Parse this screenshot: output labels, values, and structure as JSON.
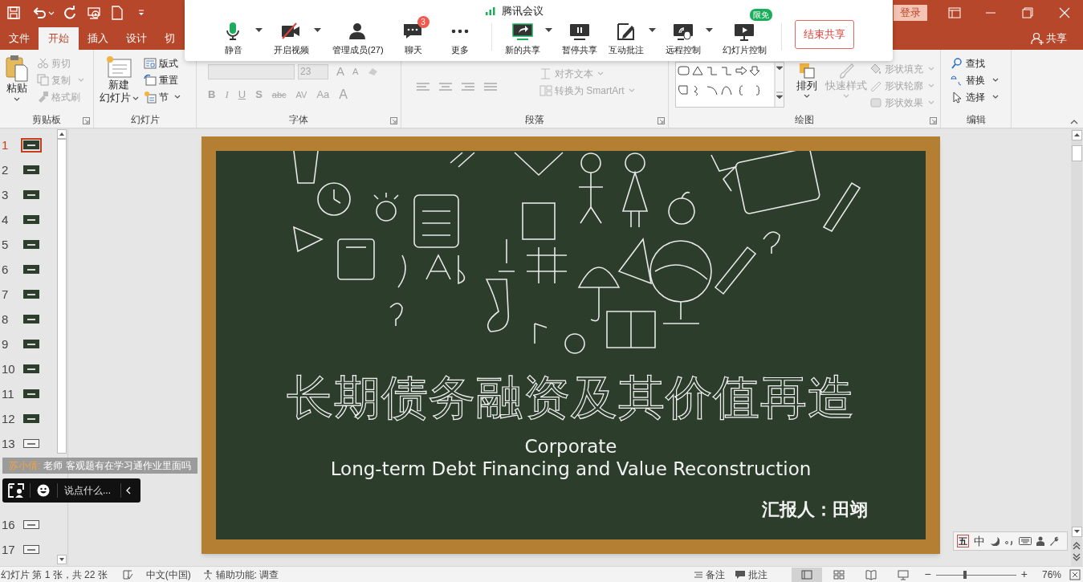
{
  "title_bar": {
    "login": "登录"
  },
  "ribbon_tabs": [
    {
      "label": "文件",
      "selected": false
    },
    {
      "label": "开始",
      "selected": true
    },
    {
      "label": "插入",
      "selected": false
    },
    {
      "label": "设计",
      "selected": false
    },
    {
      "label": "切",
      "selected": false
    }
  ],
  "share": "共享",
  "ribbon": {
    "clipboard": {
      "label": "剪贴板",
      "paste": "粘贴",
      "items": [
        {
          "label": "剪切",
          "disabled": true
        },
        {
          "label": "复制",
          "disabled": true
        },
        {
          "label": "格式刷",
          "disabled": true
        }
      ]
    },
    "slides": {
      "label": "幻灯片",
      "new_slide": [
        "新建",
        "幻灯片"
      ],
      "items": [
        "版式",
        "重置",
        "节"
      ]
    },
    "font": {
      "label": "字体",
      "size": "23",
      "grow": [
        "A",
        "A"
      ],
      "buttons": [
        "B",
        "I",
        "U",
        "S",
        "abc",
        "AV",
        "Aa",
        "A"
      ]
    },
    "paragraph": {
      "label": "段落",
      "items": [
        "对齐文本",
        "转换为 SmartArt"
      ]
    },
    "drawing": {
      "label": "绘图",
      "arrange": "排列",
      "quick_styles": "快速样式",
      "items": [
        "形状填充",
        "形状轮廓",
        "形状效果"
      ]
    },
    "editing": {
      "label": "编辑",
      "items": [
        "查找",
        "替换",
        "选择"
      ]
    }
  },
  "slides_above_chat": [
    {
      "number": "1",
      "selected": true,
      "kind": "dark"
    },
    {
      "number": "2",
      "selected": false,
      "kind": "dark"
    },
    {
      "number": "3",
      "selected": false,
      "kind": "dark"
    },
    {
      "number": "4",
      "selected": false,
      "kind": "dark"
    },
    {
      "number": "5",
      "selected": false,
      "kind": "dark"
    },
    {
      "number": "6",
      "selected": false,
      "kind": "dark"
    },
    {
      "number": "7",
      "selected": false,
      "kind": "dark"
    },
    {
      "number": "8",
      "selected": false,
      "kind": "dark"
    },
    {
      "number": "9",
      "selected": false,
      "kind": "dark"
    },
    {
      "number": "10",
      "selected": false,
      "kind": "dark"
    },
    {
      "number": "11",
      "selected": false,
      "kind": "dark"
    },
    {
      "number": "12",
      "selected": false,
      "kind": "dark"
    },
    {
      "number": "13",
      "selected": false,
      "kind": "light"
    }
  ],
  "chat": {
    "sender": "苏小倩:",
    "message": "老师 客观题有在学习通作业里面吗",
    "placeholder": "说点什么..."
  },
  "slides_below_chat": [
    {
      "number": "16",
      "selected": false,
      "kind": "light"
    },
    {
      "number": "17",
      "selected": false,
      "kind": "light"
    }
  ],
  "slide": {
    "title": "长期债务融资及其价值再造",
    "subtitle_lines": [
      "Corporate",
      "Long-term Debt Financing and Value Reconstruction"
    ],
    "presenter": "汇报人：田翊"
  },
  "meeting": {
    "app_title": "腾讯会议",
    "audio_tools": [
      {
        "kind": "mic",
        "label": "静音",
        "dropdown": true
      },
      {
        "kind": "camera",
        "label": "开启视频",
        "dropdown": true
      },
      {
        "kind": "members",
        "label": "管理成员(27)",
        "dropdown": false
      },
      {
        "kind": "chat",
        "label": "聊天",
        "dropdown": false,
        "badge": {
          "text": "3",
          "color": "#f05a4f"
        }
      },
      {
        "kind": "more",
        "label": "更多",
        "dropdown": false
      }
    ],
    "share_tools": [
      {
        "kind": "share",
        "label": "新的共享",
        "dropdown": true
      },
      {
        "kind": "pause",
        "label": "暂停共享",
        "dropdown": false
      },
      {
        "kind": "annotate",
        "label": "互动批注",
        "dropdown": true
      },
      {
        "kind": "remote",
        "label": "远程控制",
        "dropdown": true
      },
      {
        "kind": "slideshow",
        "label": "幻灯片控制",
        "dropdown": false,
        "badge": {
          "text": "限免",
          "color": "#1aad5a"
        }
      }
    ],
    "end_button": "结束共享"
  },
  "ime": {
    "mode": "五",
    "language": "中"
  },
  "status_bar": {
    "slide_info": "幻灯片 第 1 张，共 22 张",
    "language": "中文(中国)",
    "accessibility": "辅助功能: 调查",
    "notes": "备注",
    "comments": "批注",
    "views": [
      {
        "kind": "normal",
        "selected": true
      },
      {
        "kind": "sorter",
        "selected": false
      },
      {
        "kind": "reading",
        "selected": false
      },
      {
        "kind": "slideshow",
        "selected": false
      }
    ],
    "zoom_out": "−",
    "zoom_in": "+",
    "zoom": {
      "level": 0.36,
      "text": "76%"
    }
  }
}
